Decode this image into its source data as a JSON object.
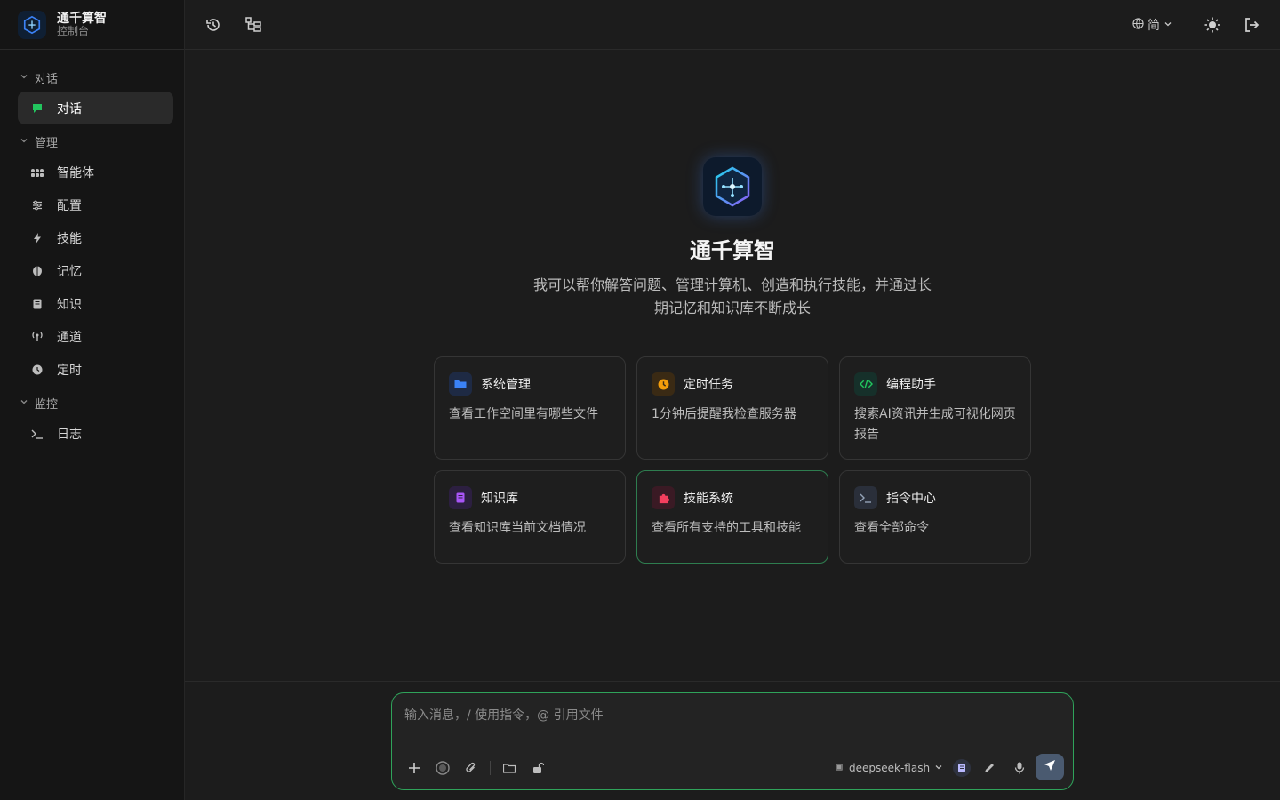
{
  "brand": {
    "title": "通千算智",
    "subtitle": "控制台"
  },
  "sidebar": {
    "groups": [
      {
        "label": "对话",
        "items": [
          {
            "label": "对话",
            "icon": "chat-icon",
            "active": true
          }
        ]
      },
      {
        "label": "管理",
        "items": [
          {
            "label": "智能体",
            "icon": "agents-icon"
          },
          {
            "label": "配置",
            "icon": "sliders-icon"
          },
          {
            "label": "技能",
            "icon": "bolt-icon"
          },
          {
            "label": "记忆",
            "icon": "brain-icon"
          },
          {
            "label": "知识",
            "icon": "book-icon"
          },
          {
            "label": "通道",
            "icon": "antenna-icon"
          },
          {
            "label": "定时",
            "icon": "clock-icon"
          }
        ]
      },
      {
        "label": "监控",
        "items": [
          {
            "label": "日志",
            "icon": "terminal-icon"
          }
        ]
      }
    ]
  },
  "topbar": {
    "language": "简"
  },
  "hero": {
    "title": "通千算智",
    "description": "我可以帮你解答问题、管理计算机、创造和执行技能，并通过长期记忆和知识库不断成长"
  },
  "cards": [
    {
      "title": "系统管理",
      "desc": "查看工作空间里有哪些文件",
      "icon": "folder-icon",
      "color": "#3b82f6"
    },
    {
      "title": "定时任务",
      "desc": "1分钟后提醒我检查服务器",
      "icon": "clock-icon",
      "color": "#f59e0b"
    },
    {
      "title": "编程助手",
      "desc": "搜索AI资讯并生成可视化网页报告",
      "icon": "code-icon",
      "color": "#22c55e"
    },
    {
      "title": "知识库",
      "desc": "查看知识库当前文档情况",
      "icon": "book-icon",
      "color": "#a855f7"
    },
    {
      "title": "技能系统",
      "desc": "查看所有支持的工具和技能",
      "icon": "puzzle-icon",
      "color": "#f43f5e"
    },
    {
      "title": "指令中心",
      "desc": "查看全部命令",
      "icon": "terminal-icon",
      "color": "#94a3b8"
    }
  ],
  "composer": {
    "placeholder": "输入消息，/ 使用指令，@ 引用文件",
    "model": "deepseek-flash"
  },
  "colors": {
    "accent": "#2fa35a",
    "background": "#1c1c1c",
    "sidebar": "#151515"
  }
}
